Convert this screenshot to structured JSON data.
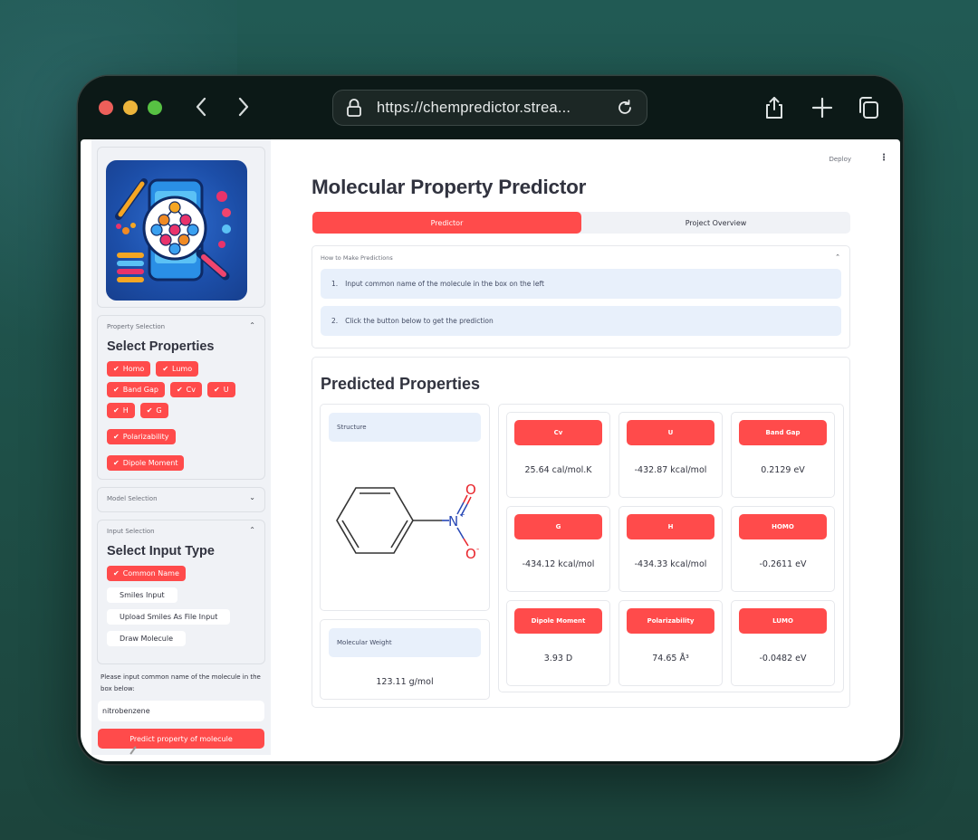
{
  "browser": {
    "url": "https://chempredictor.strea...",
    "icons": {
      "back": "chevron-left-icon",
      "forward": "chevron-right-icon",
      "lock": "lock-icon",
      "reload": "reload-icon",
      "share": "share-icon",
      "new_tab": "plus-icon",
      "tabs": "tabs-overview-icon"
    },
    "back_glyph": "‹",
    "forward_glyph": "›"
  },
  "header": {
    "deploy_label": "Deploy",
    "menu_glyph": "⋮"
  },
  "colors": {
    "primary": "#ff4b4b",
    "sidebar_bg": "#f0f2f6",
    "info_bg": "#e8f0fb",
    "text": "#31333f",
    "background": "#215a54"
  },
  "sidebar": {
    "logo_alt": "molecule-predictor-logo",
    "property_selection": {
      "label": "Property Selection",
      "title": "Select Properties",
      "expanded": true,
      "chevron": "⌃",
      "selected": [
        "Homo",
        "Lumo",
        "Band Gap",
        "Cv",
        "U",
        "H",
        "G",
        "Polarizability",
        "Dipole Moment"
      ]
    },
    "model_selection": {
      "label": "Model Selection",
      "expanded": false,
      "chevron": "⌄"
    },
    "input_selection": {
      "label": "Input Selection",
      "title": "Select Input Type",
      "expanded": true,
      "chevron": "⌃",
      "options": [
        {
          "label": "Common Name",
          "selected": true
        },
        {
          "label": "Smiles Input",
          "selected": false
        },
        {
          "label": "Upload Smiles As File Input",
          "selected": false
        },
        {
          "label": "Draw Molecule",
          "selected": false
        }
      ]
    },
    "input_prompt": "Please input common name of the molecule in the box below:",
    "molecule_input_value": "nitrobenzene",
    "predict_button": "Predict property of molecule",
    "check_glyph": "✔"
  },
  "main": {
    "title": "Molecular Property Predictor",
    "tabs": [
      {
        "label": "Predictor",
        "active": true
      },
      {
        "label": "Project Overview",
        "active": false
      }
    ],
    "howto": {
      "label": "How to Make Predictions",
      "chevron": "⌃",
      "steps": [
        {
          "num": "1.",
          "text": "Input common name of the molecule in the box on the left"
        },
        {
          "num": "2.",
          "text": "Click the button below to get the prediction"
        }
      ]
    },
    "predicted": {
      "title": "Predicted Properties",
      "structure_label": "Structure",
      "molecule": {
        "name": "nitrobenzene",
        "atoms": {
          "N": "N",
          "N_charge": "+",
          "O1": "O",
          "O2": "O",
          "O2_charge": "-"
        }
      },
      "molecular_weight_label": "Molecular Weight",
      "molecular_weight_value": "123.11 g/mol",
      "properties": [
        {
          "name": "Cv",
          "value": "25.64 cal/mol.K"
        },
        {
          "name": "U",
          "value": "-432.87 kcal/mol"
        },
        {
          "name": "Band Gap",
          "value": "0.2129 eV"
        },
        {
          "name": "G",
          "value": "-434.12 kcal/mol"
        },
        {
          "name": "H",
          "value": "-434.33 kcal/mol"
        },
        {
          "name": "HOMO",
          "value": "-0.2611 eV"
        },
        {
          "name": "Dipole Moment",
          "value": "3.93 D"
        },
        {
          "name": "Polarizability",
          "value": "74.65 Å³"
        },
        {
          "name": "LUMO",
          "value": "-0.0482 eV"
        }
      ]
    }
  }
}
